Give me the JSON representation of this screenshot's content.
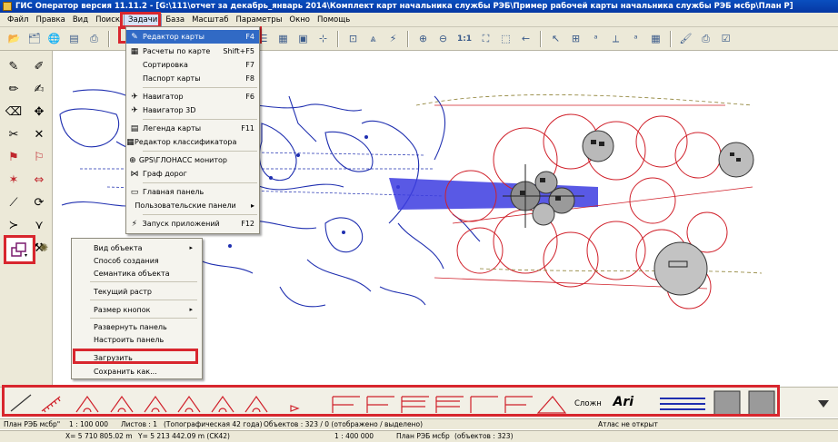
{
  "window": {
    "title": "ГИС Оператор версия 11.11.2 - [G:\\111\\отчет за декабрь_январь 2014\\Комплект карт начальника службы РЭБ\\Пример рабочей карты начальника службы РЭБ мсбр\\План Р]"
  },
  "menubar": {
    "items": [
      "Файл",
      "Правка",
      "Вид",
      "Поиск",
      "Задачи",
      "База",
      "Масштаб",
      "Параметры",
      "Окно",
      "Помощь"
    ],
    "open_item": "Задачи"
  },
  "tasks_menu": {
    "items": [
      {
        "label": "Редактор карты",
        "shortcut": "F4",
        "icon": "pencil-icon",
        "active": true
      },
      {
        "label": "Расчеты по карте",
        "shortcut": "Shift+F5",
        "icon": "calc-icon"
      },
      {
        "label": "Сортировка",
        "shortcut": "F7",
        "icon": ""
      },
      {
        "label": "Паспорт карты",
        "shortcut": "F8",
        "icon": ""
      },
      {
        "label": "Навигатор",
        "shortcut": "F6",
        "icon": "navigator-icon"
      },
      {
        "label": "Навигатор 3D",
        "shortcut": "",
        "icon": "navigator3d-icon"
      },
      {
        "label": "Легенда карты",
        "shortcut": "F11",
        "icon": "legend-icon"
      },
      {
        "label": "Редактор классификатора",
        "shortcut": "",
        "icon": "classifier-icon"
      },
      {
        "label": "GPS\\ГЛОНАСС монитор",
        "shortcut": "",
        "icon": "gps-icon"
      },
      {
        "label": "Граф дорог",
        "shortcut": "",
        "icon": "graph-icon"
      },
      {
        "label": "Главная панель",
        "shortcut": "",
        "icon": "panel-icon"
      },
      {
        "label": "Пользовательские панели",
        "shortcut": "",
        "icon": "",
        "submenu": true
      },
      {
        "label": "Запуск приложений",
        "shortcut": "F12",
        "icon": "run-icon"
      }
    ]
  },
  "context_menu": {
    "items": [
      {
        "label": "Вид объекта",
        "submenu": true
      },
      {
        "label": "Способ создания"
      },
      {
        "label": "Семантика объекта"
      },
      {
        "label": "Текущий растр"
      },
      {
        "label": "Размер кнопок",
        "submenu": true
      },
      {
        "label": "Развернуть панель"
      },
      {
        "label": "Настроить панель"
      },
      {
        "label": "Загрузить"
      },
      {
        "label": "Сохранить как..."
      }
    ]
  },
  "palette": {
    "label_complex": "Сложн",
    "label_font": "Ari"
  },
  "status": {
    "map_name": "План РЭБ мсбр\"",
    "scale": "1 : 100 000",
    "sheets": "Листов : 1",
    "topo": "(Топографическая 42 года)",
    "objects": "Объектов : 323 / 0 (отображено / выделено)",
    "atlas": "Атлас не открыт",
    "x_coord": "X= 5 710 805.02 m",
    "y_coord": "Y= 5 213 442.09 m (CK42)",
    "scale2": "1 : 400 000",
    "plan": "План РЭБ мсбр",
    "plan_objects": "(объектов : 323)"
  },
  "colors": {
    "titlebar": "#0a4fbf",
    "highlight": "#d8262e",
    "map_blue": "#1f2fb0",
    "map_red": "#d0202a",
    "menu_active": "#316ac5"
  }
}
